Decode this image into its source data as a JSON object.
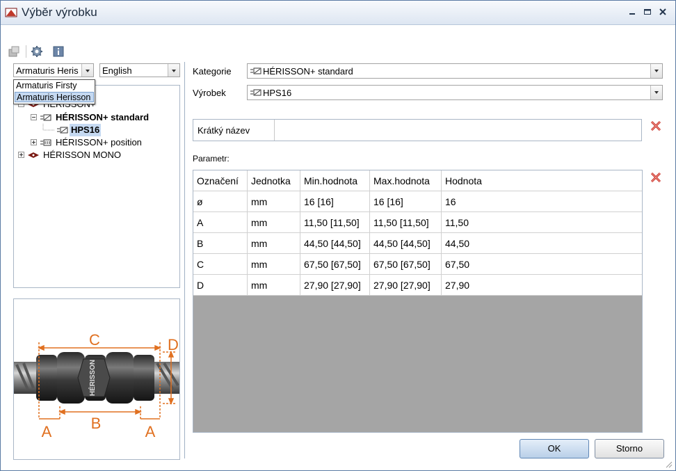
{
  "window": {
    "title": "Výběr výrobku"
  },
  "toolbar": {
    "icons": [
      "import-icon",
      "gear-icon",
      "info-icon"
    ]
  },
  "left": {
    "manufacturer_combo": {
      "value": "Armaturis Heris"
    },
    "language_combo": {
      "value": "English"
    },
    "manufacturer_dropdown": {
      "options": [
        "Armaturis Firsty",
        "Armaturis Herisson"
      ],
      "selected_index": 1
    },
    "tree": {
      "root": "HÉRISSON+",
      "category_standard": "HÉRISSON+ standard",
      "product": "HPS16",
      "category_position": "HÉRISSON+ position",
      "root2": "HÉRISSON MONO"
    },
    "diagram": {
      "labels": {
        "c": "C",
        "d": "D",
        "a_left": "A",
        "b": "B",
        "a_right": "A"
      },
      "product_text": "HÉRISSON"
    }
  },
  "right": {
    "kategorie": {
      "label": "Kategorie",
      "value": "HÉRISSON+ standard"
    },
    "vyrobek": {
      "label": "Výrobek",
      "value": "HPS16"
    },
    "kratky_nazev": {
      "label": "Krátký název",
      "value": ""
    },
    "parametr_label": "Parametr:",
    "table": {
      "headers": [
        "Označení",
        "Jednotka",
        "Min.hodnota",
        "Max.hodnota",
        "Hodnota"
      ],
      "rows": [
        [
          "ø",
          "mm",
          "16 [16]",
          "16 [16]",
          "16"
        ],
        [
          "A",
          "mm",
          "11,50 [11,50]",
          "11,50 [11,50]",
          "11,50"
        ],
        [
          "B",
          "mm",
          "44,50 [44,50]",
          "44,50 [44,50]",
          "44,50"
        ],
        [
          "C",
          "mm",
          "67,50 [67,50]",
          "67,50 [67,50]",
          "67,50"
        ],
        [
          "D",
          "mm",
          "27,90 [27,90]",
          "27,90 [27,90]",
          "27,90"
        ]
      ]
    }
  },
  "buttons": {
    "ok": "OK",
    "cancel": "Storno"
  },
  "colors": {
    "accent": "#e07020",
    "delete": "#c8281e",
    "selection": "#c5d9f1"
  }
}
